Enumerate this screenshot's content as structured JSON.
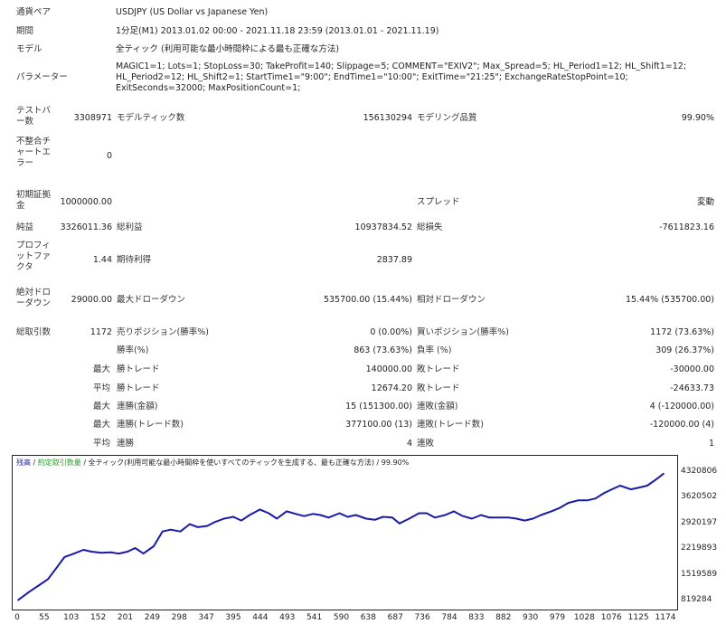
{
  "report": {
    "pair_label": "通貨ペア",
    "pair_value": "USDJPY (US Dollar vs Japanese Yen)",
    "period_label": "期間",
    "period_value": "1分足(M1) 2013.01.02 00:00 - 2021.11.18 23:59 (2013.01.01 - 2021.11.19)",
    "model_label": "モデル",
    "model_value": "全ティック (利用可能な最小時間枠による最も正確な方法)",
    "params_label": "パラメーター",
    "params_value": "MAGIC1=1; Lots=1; StopLoss=30; TakeProfit=140; Slippage=5; COMMENT=\"EXIV2\"; Max_Spread=5; HL_Period1=12; HL_Shift1=12; HL_Period2=12; HL_Shift2=1; StartTime1=\"9:00\"; EndTime1=\"10:00\"; ExitTime=\"21:25\"; ExchangeRateStopPoint=10; ExitSeconds=32000; MaxPositionCount=1;",
    "bars_label": "テストバー数",
    "bars_value": "3308971",
    "ticks_label": "モデルティック数",
    "ticks_value": "156130294",
    "quality_label": "モデリング品質",
    "quality_value": "99.90%",
    "mismatch_label": "不整合チャートエラー",
    "mismatch_value": "0",
    "deposit_label": "初期証拠金",
    "deposit_value": "1000000.00",
    "spread_label": "スプレッド",
    "spread_value": "変動",
    "net_label": "純益",
    "net_value": "3326011.36",
    "gross_profit_label": "総利益",
    "gross_profit_value": "10937834.52",
    "gross_loss_label": "総損失",
    "gross_loss_value": "-7611823.16",
    "pf_label": "プロフィットファクタ",
    "pf_value": "1.44",
    "expected_label": "期待利得",
    "expected_value": "2837.89",
    "abs_dd_label": "絶対ドローダウン",
    "abs_dd_value": "29000.00",
    "max_dd_label": "最大ドローダウン",
    "max_dd_value": "535700.00 (15.44%)",
    "rel_dd_label": "相対ドローダウン",
    "rel_dd_value": "15.44% (535700.00)",
    "trades_label": "総取引数",
    "trades_value": "1172",
    "short_label": "売りポジション(勝率%)",
    "short_value": "0 (0.00%)",
    "long_label": "買いポジション(勝率%)",
    "long_value": "1172 (73.63%)",
    "win_label": "勝率(%)",
    "win_value": "863 (73.63%)",
    "lose_label": "負率 (%)",
    "lose_value": "309 (26.37%)",
    "max_word": "最大",
    "avg_word": "平均",
    "largest_win_label": "勝トレード",
    "largest_win_value": "140000.00",
    "largest_loss_label": "敗トレード",
    "largest_loss_value": "-30000.00",
    "avg_win_label": "勝トレード",
    "avg_win_value": "12674.20",
    "avg_loss_label": "敗トレード",
    "avg_loss_value": "-24633.73",
    "consec_win_money_label": "連勝(金額)",
    "consec_win_money_value": "15 (151300.00)",
    "consec_loss_money_label": "連敗(金額)",
    "consec_loss_money_value": "4 (-120000.00)",
    "consec_win_count_label": "連勝(トレード数)",
    "consec_win_count_value": "377100.00 (13)",
    "consec_loss_count_label": "連敗(トレード数)",
    "consec_loss_count_value": "-120000.00 (4)",
    "avg_consec_win_label": "連勝",
    "avg_consec_win_value": "4",
    "avg_consec_loss_label": "連敗",
    "avg_consec_loss_value": "1"
  },
  "chart_legend": {
    "balance": "残高",
    "sep1": " / ",
    "lots": "約定取引数量",
    "sep2": " / ",
    "model": "全ティック(利用可能な最小時間枠を使いすべてのティックを生成する、最も正確な方法)",
    "sep3": " / ",
    "quality": "99.90%"
  },
  "chart_data": {
    "type": "line",
    "series": [
      {
        "color": "#1a1aa8",
        "x": [
          0,
          20,
          40,
          55,
          70,
          85,
          103,
          120,
          135,
          152,
          170,
          185,
          201,
          215,
          230,
          249,
          265,
          280,
          298,
          315,
          330,
          347,
          360,
          378,
          395,
          410,
          425,
          444,
          460,
          475,
          493,
          510,
          525,
          541,
          555,
          570,
          590,
          605,
          620,
          639,
          655,
          670,
          687,
          700,
          718,
          736,
          750,
          765,
          784,
          800,
          815,
          833,
          850,
          865,
          882,
          900,
          915,
          930,
          945,
          960,
          979,
          995,
          1010,
          1028,
          1045,
          1060,
          1076,
          1090,
          1105,
          1125,
          1140,
          1155,
          1174,
          1185
        ],
        "y": [
          830000,
          1050000,
          1250000,
          1400000,
          1700000,
          2000000,
          2100000,
          2200000,
          2150000,
          2120000,
          2130000,
          2100000,
          2150000,
          2250000,
          2100000,
          2300000,
          2700000,
          2750000,
          2700000,
          2900000,
          2820000,
          2850000,
          2950000,
          3050000,
          3100000,
          3000000,
          3150000,
          3300000,
          3200000,
          3050000,
          3250000,
          3180000,
          3120000,
          3180000,
          3150000,
          3080000,
          3200000,
          3100000,
          3150000,
          3050000,
          3020000,
          3100000,
          3080000,
          2920000,
          3050000,
          3200000,
          3200000,
          3080000,
          3150000,
          3250000,
          3130000,
          3050000,
          3150000,
          3080000,
          3080000,
          3080000,
          3050000,
          3000000,
          3050000,
          3150000,
          3250000,
          3350000,
          3480000,
          3550000,
          3550000,
          3600000,
          3750000,
          3850000,
          3950000,
          3850000,
          3900000,
          3950000,
          4150000,
          4280000
        ]
      }
    ],
    "ylim": [
      819284,
      4320806
    ],
    "xlim": [
      0,
      1200
    ],
    "yticks": [
      "4320806",
      "3620502",
      "2920197",
      "2219893",
      "1519589",
      "819284"
    ],
    "xticks": [
      "0",
      "55",
      "103",
      "152",
      "201",
      "249",
      "298",
      "347",
      "395",
      "444",
      "493",
      "541",
      "590",
      "638",
      "687",
      "736",
      "784",
      "833",
      "882",
      "930",
      "979",
      "1028",
      "1076",
      "1125",
      "1174"
    ],
    "grid": false
  }
}
